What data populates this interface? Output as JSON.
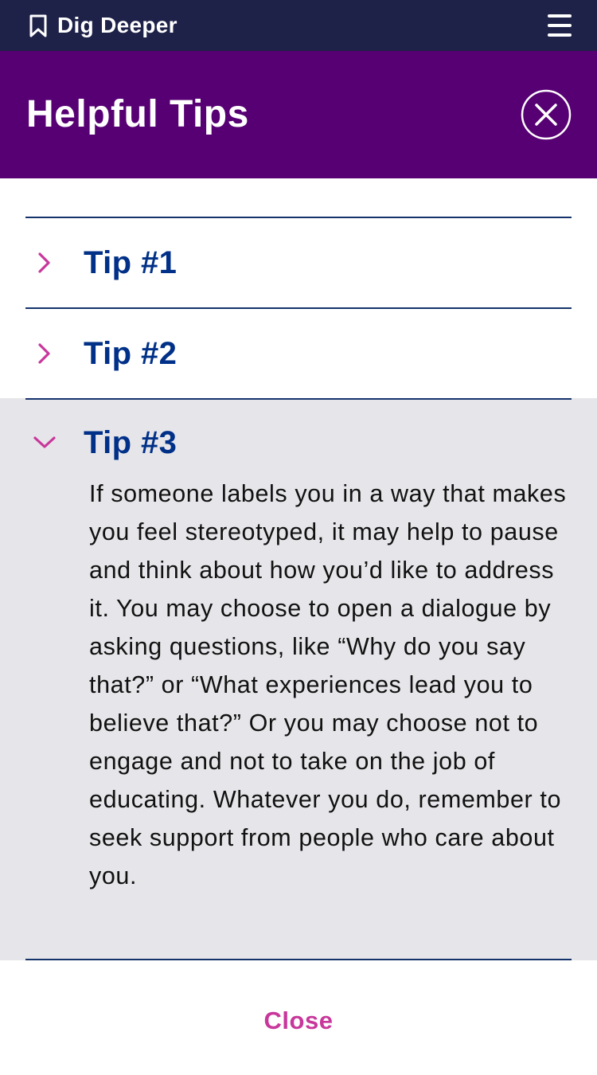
{
  "topbar": {
    "app_title": "Dig Deeper",
    "bookmark_icon": "bookmark-icon",
    "menu_icon": "hamburger-menu-icon"
  },
  "header": {
    "title": "Helpful Tips",
    "close_icon": "close-circle-icon"
  },
  "accordion": {
    "items": [
      {
        "label": "Tip #1",
        "expanded": false,
        "icon": "chevron-right-icon"
      },
      {
        "label": "Tip #2",
        "expanded": false,
        "icon": "chevron-right-icon"
      },
      {
        "label": "Tip #3",
        "expanded": true,
        "icon": "chevron-down-icon",
        "body": "If someone labels you in a way that makes you feel stereotyped, it may help to pause and think about how you’d like to address it. You may choose to open a dialogue by asking questions, like “Why do you say that?” or “What experiences lead you to believe that?” Or you may choose not to engage and not to take on the job of educating. Whatever you do, remember to seek support from people who care about you."
      }
    ]
  },
  "footer": {
    "close_label": "Close"
  },
  "colors": {
    "topbar": "#1f2248",
    "header": "#570073",
    "tip_label": "#003087",
    "accent": "#c8379b",
    "expanded_bg": "#e6e6ea"
  }
}
